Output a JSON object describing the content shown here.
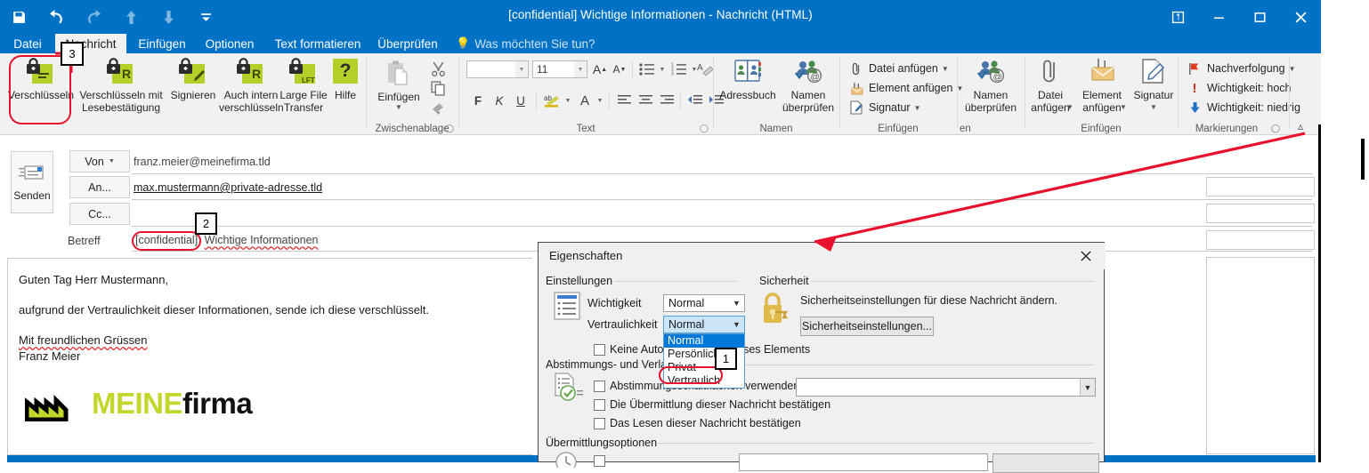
{
  "window": {
    "title": "[confidential] Wichtige Informationen - Nachricht (HTML)",
    "quick_access": [
      "save-icon",
      "undo-icon",
      "redo-icon",
      "up-icon",
      "down-icon",
      "customize-qat-icon"
    ],
    "controls": [
      "restore-down-icon",
      "minimize-icon",
      "maximize-icon",
      "close-icon"
    ]
  },
  "tabs": [
    {
      "label": "Datei",
      "active": false
    },
    {
      "label": "Nachricht",
      "active": true
    },
    {
      "label": "Einfügen",
      "active": false
    },
    {
      "label": "Optionen",
      "active": false
    },
    {
      "label": "Text formatieren",
      "active": false
    },
    {
      "label": "Überprüfen",
      "active": false
    }
  ],
  "tell_me": "Was möchten Sie tun?",
  "ribbon": {
    "groups": [
      {
        "name": "encryption-group",
        "label": "",
        "buttons": [
          {
            "label": "Verschlüsseln",
            "icon": "lock-document-icon"
          },
          {
            "label": "Verschlüsseln mit Lesebestätigung",
            "icon": "lock-document-r-icon"
          },
          {
            "label": "Signieren",
            "icon": "lock-document-pen-icon"
          },
          {
            "label": "Auch intern verschlüsseln",
            "icon": "lock-document-r-icon"
          },
          {
            "label": "Large File Transfer",
            "icon": "lock-document-lft-icon"
          },
          {
            "label": "Hilfe",
            "icon": "question-mark-icon"
          }
        ]
      },
      {
        "name": "clipboard-group",
        "label": "Zwischenablage",
        "paste_label": "Einfügen",
        "items": [
          "paste-icon",
          "cut-scissors-icon",
          "copy-icon",
          "format-painter-icon"
        ]
      },
      {
        "name": "text-group",
        "label": "Text",
        "font_name": "",
        "font_size": "11",
        "buttons": [
          "grow-font-icon",
          "shrink-font-icon",
          "bullets-icon",
          "numbering-icon",
          "clear-formatting-icon",
          "bold-icon",
          "italic-icon",
          "underline-icon",
          "highlight-icon",
          "font-color-icon",
          "align-left-icon",
          "align-center-icon",
          "align-right-icon",
          "decrease-indent-icon",
          "increase-indent-icon"
        ],
        "bold_label": "F",
        "italic_label": "K",
        "underline_label": "U"
      },
      {
        "name": "names-group",
        "label": "Namen",
        "buttons": [
          {
            "label": "Adressbuch",
            "icon": "address-book-icon"
          },
          {
            "label": "Namen überprüfen",
            "icon": "check-names-icon"
          }
        ]
      },
      {
        "name": "include-group",
        "label": "Einfügen",
        "items": [
          {
            "label": "Datei anfügen",
            "icon": "paperclip-icon",
            "dropdown": true
          },
          {
            "label": "Element anfügen",
            "icon": "attach-item-icon",
            "dropdown": true
          },
          {
            "label": "Signatur",
            "icon": "signature-icon",
            "dropdown": true
          }
        ]
      },
      {
        "name": "names-group-overflow",
        "label": "en",
        "buttons": [
          {
            "label": "Namen überprüfen",
            "icon": "check-names-icon"
          }
        ]
      },
      {
        "name": "include-group-overflow",
        "label": "Einfügen",
        "buttons": [
          {
            "label": "Datei anfügen",
            "icon": "paperclip-icon"
          },
          {
            "label": "Element anfügen",
            "icon": "attach-item-icon"
          },
          {
            "label": "Signatur",
            "icon": "signature-icon"
          }
        ]
      },
      {
        "name": "tags-group",
        "label": "Markierungen",
        "items": [
          {
            "label": "Nachverfolgung",
            "icon": "flag-icon",
            "dropdown": true
          },
          {
            "label": "Wichtigkeit: hoch",
            "icon": "exclamation-icon"
          },
          {
            "label": "Wichtigkeit: niedrig",
            "icon": "arrow-down-icon"
          }
        ],
        "dialog_launcher": "dialog-launcher-icon",
        "collapse": "collapse-ribbon-icon"
      }
    ]
  },
  "header": {
    "send_label": "Senden",
    "send_icon": "send-envelope-icon",
    "fields": [
      {
        "name": "von",
        "label": "Von",
        "value": "franz.meier@meinefirma.tld",
        "dropdown": true
      },
      {
        "name": "an",
        "label": "An...",
        "value": "max.mustermann@private-adresse.tld",
        "dropdown": false
      },
      {
        "name": "cc",
        "label": "Cc...",
        "value": "",
        "dropdown": false
      }
    ],
    "subject_label": "Betreff",
    "subject_tag": "[confidential]",
    "subject_text": "Wichtige Informationen"
  },
  "body": {
    "lines": [
      "Guten Tag Herr Mustermann,",
      "aufgrund der Vertraulichkeit dieser Informationen, sende ich diese verschlüsselt.",
      "Mit freundlichen Grüssen",
      "Franz Meier"
    ],
    "signature_logo": {
      "icon": "factory-logo-icon",
      "text_a": "MEINE",
      "text_b": "firma",
      "color_a": "#c3d62b",
      "color_b": "#111111"
    }
  },
  "dialog": {
    "title": "Eigenschaften",
    "close_icon": "close-icon",
    "groups": {
      "settings": {
        "label": "Einstellungen",
        "icon": "settings-list-icon",
        "importance_label": "Wichtigkeit",
        "importance_value": "Normal",
        "sensitivity_label": "Vertraulichkeit",
        "sensitivity_value": "Normal",
        "sensitivity_options": [
          "Normal",
          "Persönlich",
          "Privat",
          "Vertraulich"
        ],
        "sensitivity_highlighted": "Normal",
        "sensitivity_target": "Vertraulich",
        "no_autoarchive_label": "Keine AutoArchivierung dieses Elements"
      },
      "security": {
        "label": "Sicherheit",
        "icon": "padlock-key-icon",
        "description": "Sicherheitseinstellungen für diese Nachricht ändern.",
        "button_label": "Sicherheitseinstellungen..."
      },
      "tracking": {
        "label": "Abstimmungs- und Verlaufsoptionen",
        "icon": "voting-tracking-icon",
        "checkboxes": [
          "Abstimmungsschaltflächen verwenden",
          "Die Übermittlung dieser Nachricht bestätigen",
          "Das Lesen dieser Nachricht bestätigen"
        ]
      },
      "delivery": {
        "label": "Übermittlungsoptionen",
        "icon": "clock-icon"
      }
    }
  },
  "annotations": {
    "markers": [
      {
        "id": "1",
        "target": "Vertraulich option in Vertraulichkeit dropdown"
      },
      {
        "id": "2",
        "target": "[confidential] subject tag"
      },
      {
        "id": "3",
        "target": "Verschlüsseln ribbon button"
      }
    ],
    "accent_color": "#e8112d"
  }
}
